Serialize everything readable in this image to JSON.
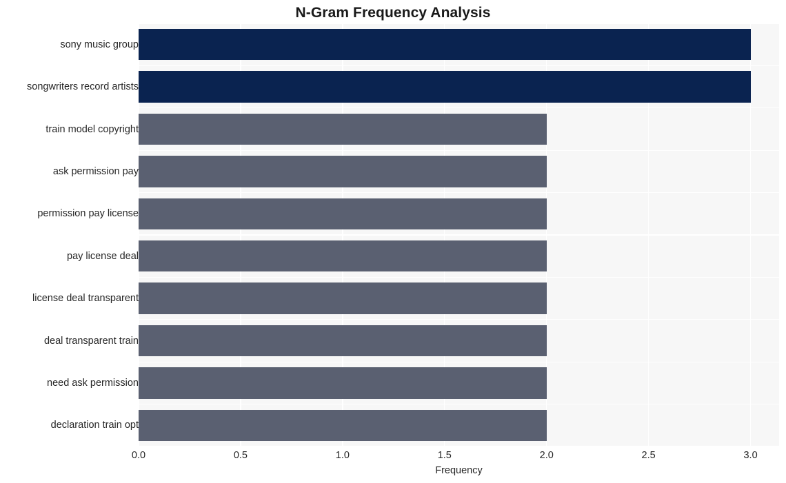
{
  "chart_data": {
    "type": "bar",
    "orientation": "horizontal",
    "title": "N-Gram Frequency Analysis",
    "xlabel": "Frequency",
    "ylabel": "",
    "xlim": [
      0.0,
      3.14
    ],
    "ylim": [
      0,
      10
    ],
    "grid": true,
    "legend": null,
    "xticks": [
      "0.0",
      "0.5",
      "1.0",
      "1.5",
      "2.0",
      "2.5",
      "3.0"
    ],
    "xtick_values": [
      0.0,
      0.5,
      1.0,
      1.5,
      2.0,
      2.5,
      3.0
    ],
    "categories": [
      "sony music group",
      "songwriters record artists",
      "train model copyright",
      "ask permission pay",
      "permission pay license",
      "pay license deal",
      "license deal transparent",
      "deal transparent train",
      "need ask permission",
      "declaration train opt"
    ],
    "values": [
      3,
      3,
      2,
      2,
      2,
      2,
      2,
      2,
      2,
      2
    ],
    "bar_colors": [
      "#0a2350",
      "#0a2350",
      "#5a6071",
      "#5a6071",
      "#5a6071",
      "#5a6071",
      "#5a6071",
      "#5a6071",
      "#5a6071",
      "#5a6071"
    ],
    "colors": {
      "highlight": "#0a2350",
      "base": "#5a6071",
      "plot_background": "#f7f7f7",
      "figure_background": "#ffffff",
      "gridline": "#ffffff",
      "text": "#262626",
      "title": "#1a1a1a"
    }
  }
}
